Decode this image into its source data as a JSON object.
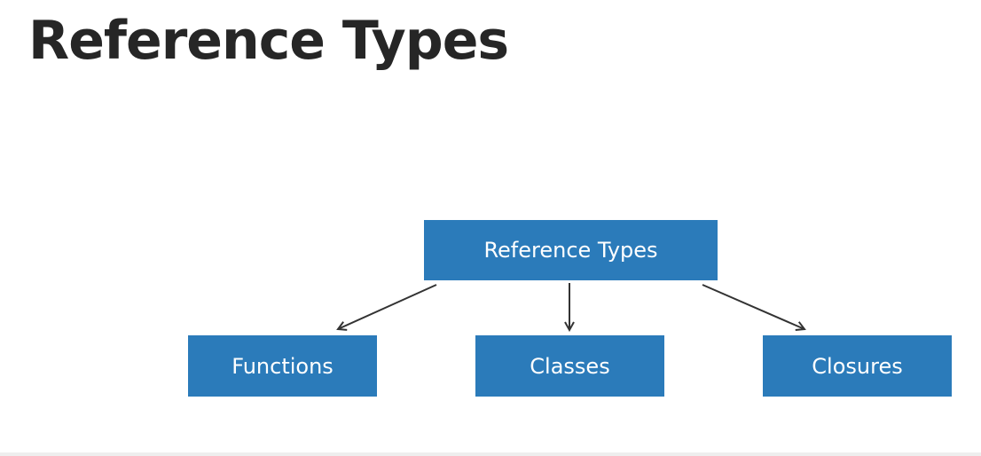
{
  "slide": {
    "title": "Reference Types"
  },
  "diagram": {
    "root": {
      "label": "Reference Types"
    },
    "children": [
      {
        "label": "Functions"
      },
      {
        "label": "Classes"
      },
      {
        "label": "Closures"
      }
    ]
  },
  "colors": {
    "box_fill": "#2b7bba",
    "box_text": "#ffffff",
    "title_text": "#262626",
    "arrow": "#333333"
  }
}
